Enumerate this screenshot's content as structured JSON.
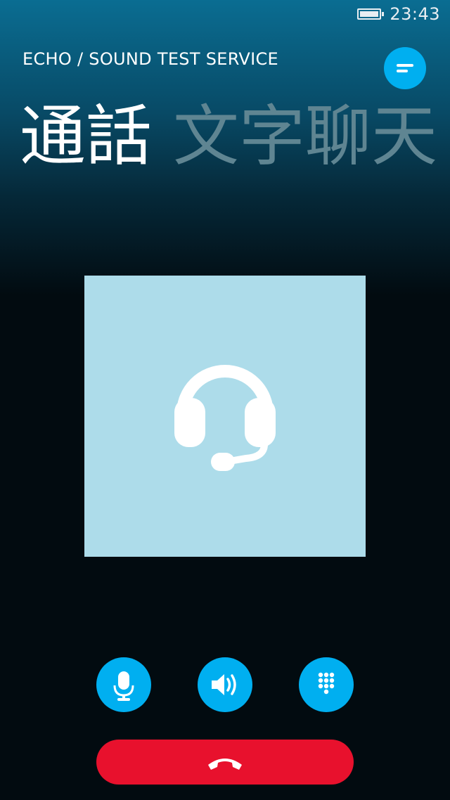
{
  "status_bar": {
    "time": "23:43",
    "battery_icon": "battery-full-icon"
  },
  "call": {
    "contact_name": "ECHO / SOUND TEST SERVICE",
    "menu_icon": "menu-icon",
    "avatar_icon": "headset-icon"
  },
  "pivot": {
    "tabs": [
      {
        "label": "通話",
        "active": true
      },
      {
        "label": "文字聊天",
        "active": false
      }
    ]
  },
  "controls": {
    "mic_icon": "microphone-icon",
    "speaker_icon": "speaker-icon",
    "dialpad_icon": "dialpad-icon",
    "end_call_icon": "hang-up-icon"
  },
  "colors": {
    "accent": "#00aff0",
    "end_call": "#e8112d",
    "avatar_bg": "#addcea",
    "inactive_tab": "#5f8592"
  }
}
